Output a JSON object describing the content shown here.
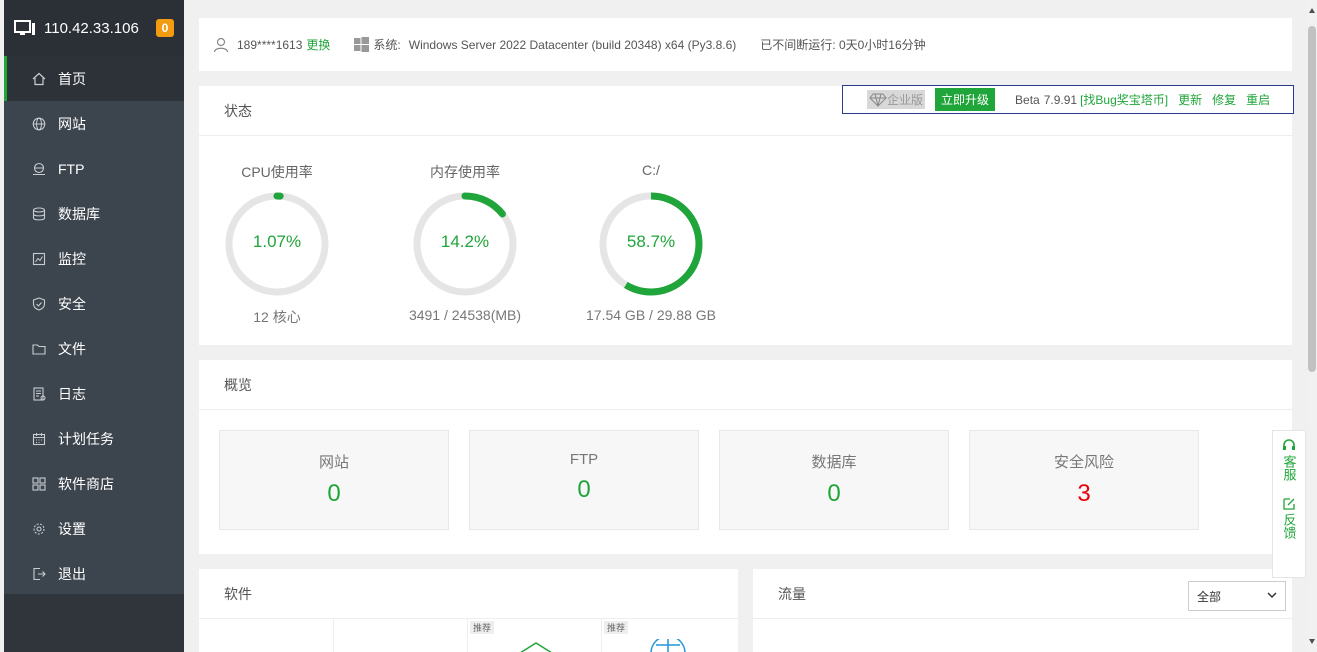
{
  "sidebar": {
    "ip": "110.42.33.106",
    "badge": "0",
    "items": [
      {
        "label": "首页",
        "icon": "home-icon"
      },
      {
        "label": "网站",
        "icon": "globe-icon"
      },
      {
        "label": "FTP",
        "icon": "ftp-icon"
      },
      {
        "label": "数据库",
        "icon": "database-icon"
      },
      {
        "label": "监控",
        "icon": "monitor-icon"
      },
      {
        "label": "安全",
        "icon": "shield-icon"
      },
      {
        "label": "文件",
        "icon": "folder-icon"
      },
      {
        "label": "日志",
        "icon": "log-icon"
      },
      {
        "label": "计划任务",
        "icon": "calendar-icon"
      },
      {
        "label": "软件商店",
        "icon": "grid-icon"
      },
      {
        "label": "设置",
        "icon": "gear-icon"
      },
      {
        "label": "退出",
        "icon": "logout-icon"
      }
    ]
  },
  "topbar": {
    "user": "189****1613",
    "change": "更换",
    "sys_label": "系统:",
    "sys_value": "Windows Server 2022 Datacenter (build 20348) x64 (Py3.8.6)",
    "uptime": "已不间断运行: 0天0小时16分钟"
  },
  "version": {
    "enterprise": "企业版",
    "upgrade": "立即升级",
    "beta": "Beta",
    "ver": "7.9.91",
    "bug": "[找Bug奖宝塔币]",
    "update": "更新",
    "repair": "修复",
    "restart": "重启"
  },
  "status": {
    "title": "状态",
    "gauges": [
      {
        "title": "CPU使用率",
        "value": "1.07%",
        "percent": 1.07,
        "sub": "12 核心"
      },
      {
        "title": "内存使用率",
        "value": "14.2%",
        "percent": 14.2,
        "sub": "3491 / 24538(MB)"
      },
      {
        "title": "C:/",
        "value": "58.7%",
        "percent": 58.7,
        "sub": "17.54 GB / 29.88 GB"
      }
    ]
  },
  "overview": {
    "title": "概览",
    "boxes": [
      {
        "label": "网站",
        "value": "0"
      },
      {
        "label": "FTP",
        "value": "0"
      },
      {
        "label": "数据库",
        "value": "0"
      },
      {
        "label": "安全风险",
        "value": "3"
      }
    ]
  },
  "software": {
    "title": "软件",
    "tag1": "推荐",
    "tag2": "推荐"
  },
  "traffic": {
    "title": "流量",
    "select": "全部"
  },
  "float": {
    "service": "客服",
    "feedback": "反馈"
  },
  "colors": {
    "accent": "#20a53a",
    "danger": "#e8000b",
    "sidebar": "#3c444d"
  }
}
